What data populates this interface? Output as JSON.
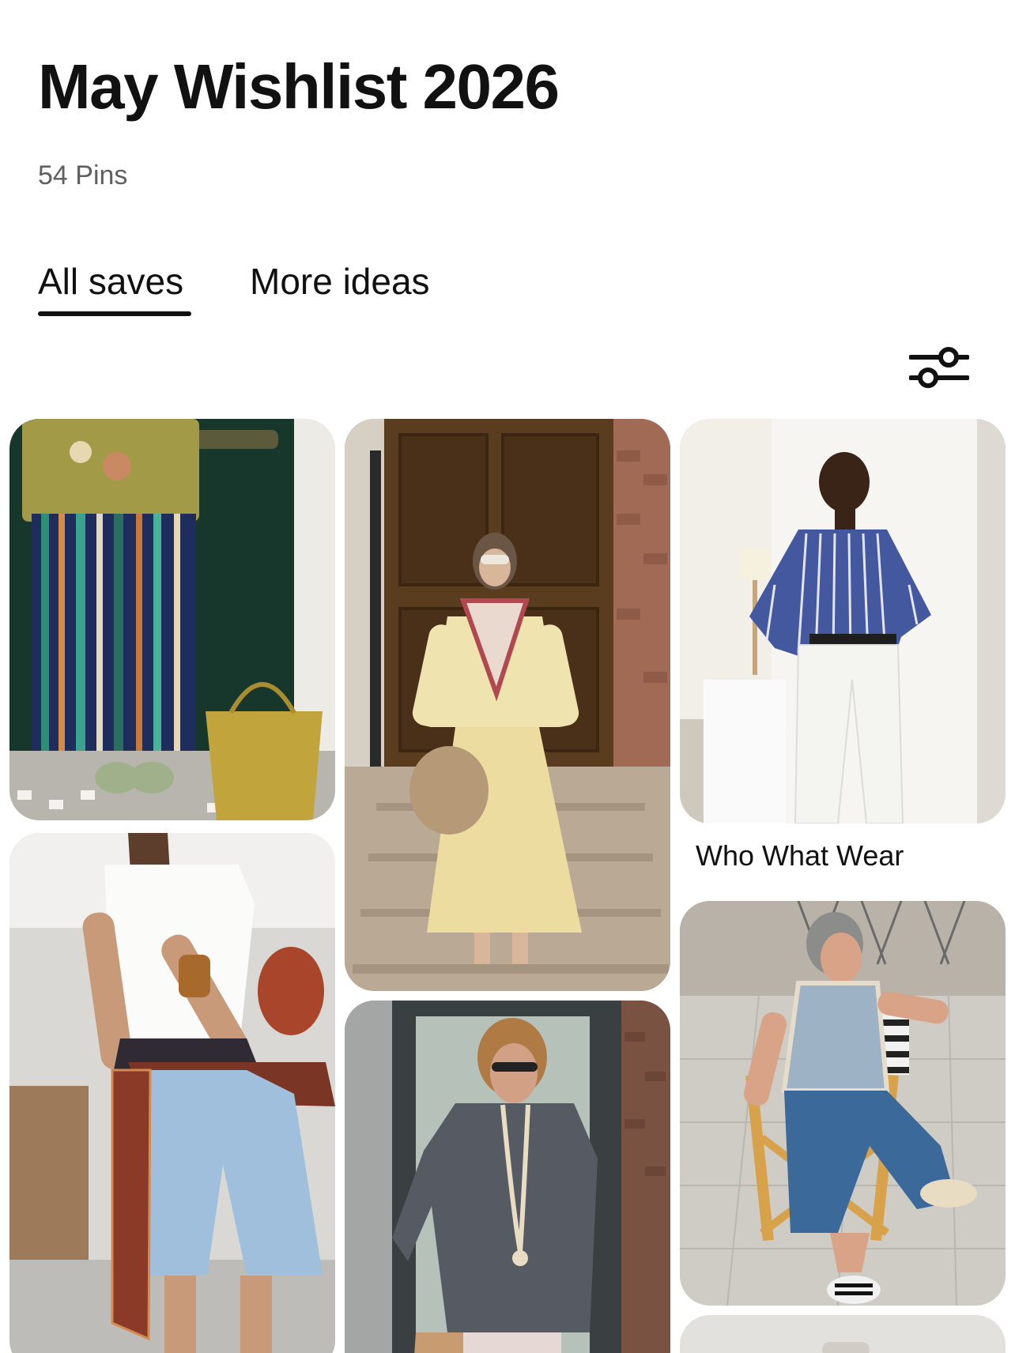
{
  "board": {
    "title": "May Wishlist 2026",
    "pin_count": "54 Pins"
  },
  "tabs": [
    {
      "label": "All saves",
      "active": true
    },
    {
      "label": "More ideas",
      "active": false
    }
  ],
  "toolbar": {
    "filter_icon": "sliders-icon"
  },
  "pins": [
    {
      "id": "pin-1",
      "description": "striped wide-leg trousers with woven basket"
    },
    {
      "id": "pin-2",
      "description": "headscarf, cream blouse and yellow maxi skirt"
    },
    {
      "id": "pin-3",
      "description": "blue striped shirt with white trousers",
      "source": "Who What Wear"
    },
    {
      "id": "pin-4",
      "description": "white tee, scarf belt and denim shorts"
    },
    {
      "id": "pin-5",
      "description": "grey linen shirt with long necklace"
    },
    {
      "id": "pin-6",
      "description": "denim vest and wide jeans on director chair"
    }
  ],
  "colors": {
    "text_primary": "#111111",
    "text_secondary": "#5f5f5f",
    "background": "#ffffff"
  }
}
